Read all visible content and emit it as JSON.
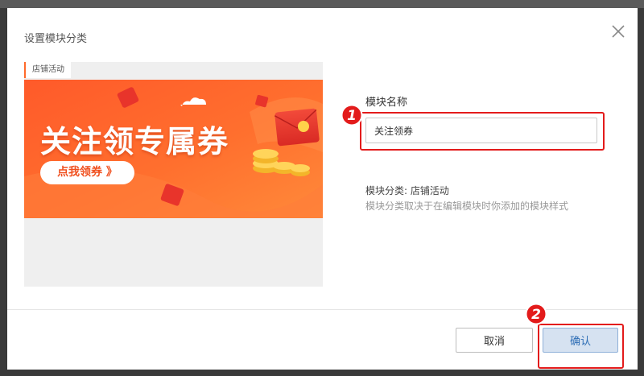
{
  "dialog": {
    "title": "设置模块分类",
    "close_icon": "close-icon"
  },
  "preview": {
    "tab_label": "店铺活动",
    "headline": "关注领专属券",
    "cta_label": "点我领券 》",
    "coin_symbol": "¥"
  },
  "form": {
    "name_label": "模块名称",
    "name_value": "关注领券",
    "category_line": "模块分类: 店铺活动",
    "category_hint": "模块分类取决于在编辑模块时你添加的模块样式"
  },
  "buttons": {
    "cancel": "取消",
    "confirm": "确认"
  },
  "annotations": {
    "marker_1": "1",
    "marker_2": "2",
    "highlight_color": "#e31b1b"
  },
  "colors": {
    "banner_orange": "#ff6a2b",
    "banner_red": "#f23b2e",
    "confirm_text": "#2d6db5"
  }
}
